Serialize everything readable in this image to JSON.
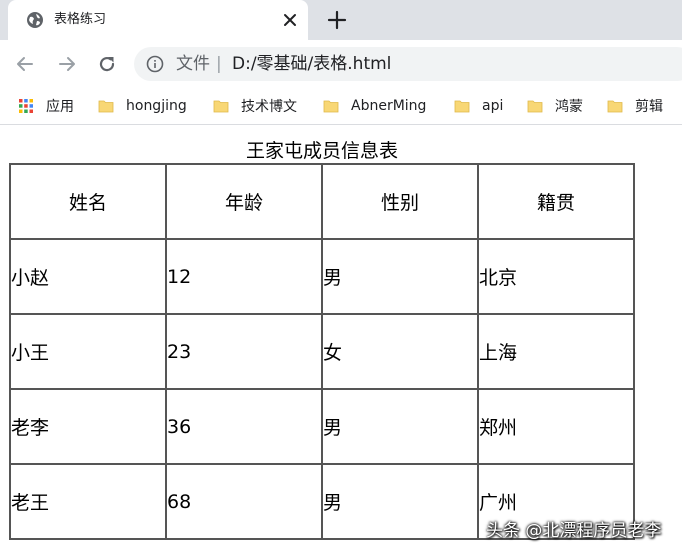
{
  "tab": {
    "title": "表格练习"
  },
  "omnibox": {
    "label": "文件",
    "separator": "|",
    "url": "D:/零基础/表格.html"
  },
  "bookmarks": [
    {
      "label": "应用",
      "icon": "apps-grid-icon"
    },
    {
      "label": "hongjing",
      "icon": "folder-icon"
    },
    {
      "label": "技术博文",
      "icon": "folder-icon"
    },
    {
      "label": "AbnerMing",
      "icon": "folder-icon"
    },
    {
      "label": "api",
      "icon": "folder-icon"
    },
    {
      "label": "鸿蒙",
      "icon": "folder-icon"
    },
    {
      "label": "剪辑",
      "icon": "folder-icon"
    }
  ],
  "table": {
    "caption": "王家屯成员信息表",
    "headers": [
      "姓名",
      "年龄",
      "性别",
      "籍贯"
    ],
    "rows": [
      [
        "小赵",
        "12",
        "男",
        "北京"
      ],
      [
        "小王",
        "23",
        "女",
        "上海"
      ],
      [
        "老李",
        "36",
        "男",
        "郑州"
      ],
      [
        "老王",
        "68",
        "男",
        "广州"
      ]
    ]
  },
  "watermark": "头条 @北漂程序员老李",
  "colors": {
    "tabstrip": "#dee1e6",
    "folder": "#f8d775",
    "border": "#555555"
  }
}
